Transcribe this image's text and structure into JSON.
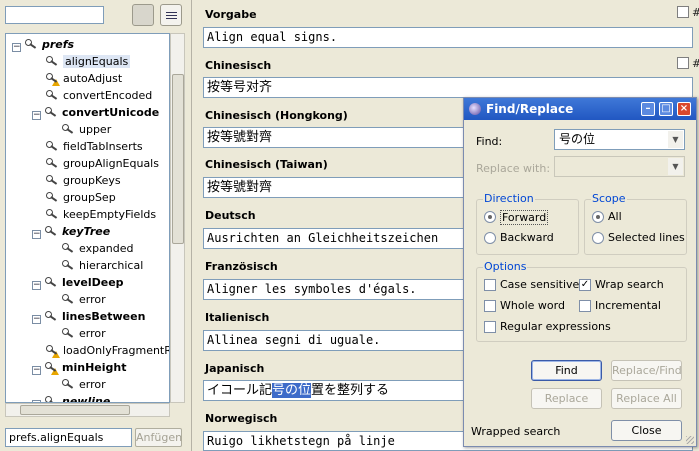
{
  "left": {
    "filter_value": "",
    "tree": [
      {
        "label": "prefs",
        "icon": "key-icon",
        "style": "bold-italic",
        "expander": "minus",
        "selected": false,
        "warn": false
      },
      {
        "label": "alignEquals",
        "icon": "key-icon",
        "style": "normal",
        "selected": true,
        "warn": false
      },
      {
        "label": "autoAdjust",
        "icon": "key-warning-icon",
        "style": "normal",
        "selected": false,
        "warn": true
      },
      {
        "label": "convertEncoded",
        "icon": "key-icon",
        "style": "normal",
        "selected": false,
        "warn": false
      },
      {
        "label": "convertUnicode",
        "icon": "key-icon",
        "style": "bold",
        "expander": "minus",
        "selected": false,
        "warn": false
      },
      {
        "label": "upper",
        "icon": "key-icon",
        "style": "normal",
        "selected": false,
        "warn": false
      },
      {
        "label": "fieldTabInserts",
        "icon": "key-icon",
        "style": "normal",
        "selected": false,
        "warn": false
      },
      {
        "label": "groupAlignEquals",
        "icon": "key-icon",
        "style": "normal",
        "selected": false,
        "warn": false
      },
      {
        "label": "groupKeys",
        "icon": "key-icon",
        "style": "normal",
        "selected": false,
        "warn": false
      },
      {
        "label": "groupSep",
        "icon": "key-icon",
        "style": "normal",
        "selected": false,
        "warn": false
      },
      {
        "label": "keepEmptyFields",
        "icon": "key-icon",
        "style": "normal",
        "selected": false,
        "warn": false
      },
      {
        "label": "keyTree",
        "icon": "key-icon",
        "style": "bold-italic",
        "expander": "minus",
        "selected": false,
        "warn": false
      },
      {
        "label": "expanded",
        "icon": "key-icon",
        "style": "normal",
        "selected": false,
        "warn": false
      },
      {
        "label": "hierarchical",
        "icon": "key-icon",
        "style": "normal",
        "selected": false,
        "warn": false
      },
      {
        "label": "levelDeep",
        "icon": "key-icon",
        "style": "bold",
        "expander": "minus",
        "selected": false,
        "warn": false
      },
      {
        "label": "error",
        "icon": "key-icon",
        "style": "normal",
        "selected": false,
        "warn": false
      },
      {
        "label": "linesBetween",
        "icon": "key-icon",
        "style": "bold",
        "expander": "minus",
        "selected": false,
        "warn": false
      },
      {
        "label": "error",
        "icon": "key-icon",
        "style": "normal",
        "selected": false,
        "warn": false
      },
      {
        "label": "loadOnlyFragmentRe",
        "icon": "key-warning-icon",
        "style": "normal",
        "selected": false,
        "warn": true
      },
      {
        "label": "minHeight",
        "icon": "key-warning-icon",
        "style": "bold",
        "expander": "minus",
        "selected": false,
        "warn": true
      },
      {
        "label": "error",
        "icon": "key-icon",
        "style": "normal",
        "selected": false,
        "warn": false
      },
      {
        "label": "newline",
        "icon": "key-icon",
        "style": "bold-italic",
        "expander": "minus",
        "selected": false,
        "warn": false
      }
    ],
    "key_input": "prefs.alignEquals",
    "add_button": "Anfügen"
  },
  "main": {
    "sections": [
      {
        "label": "Vorgabe",
        "value": "Align equal signs.",
        "cjk": false,
        "hash": true
      },
      {
        "label": "Chinesisch",
        "value": "按等号对齐",
        "cjk": true,
        "hash": true
      },
      {
        "label": "Chinesisch (Hongkong)",
        "value": "按等號對齊",
        "cjk": true,
        "hash": false
      },
      {
        "label": "Chinesisch (Taiwan)",
        "value": "按等號對齊",
        "cjk": true,
        "hash": false
      },
      {
        "label": "Deutsch",
        "value": "Ausrichten an Gleichheitszeichen",
        "cjk": false,
        "hash": false
      },
      {
        "label": "Französisch",
        "value": "Aligner les symboles d'égals.",
        "cjk": false,
        "hash": false
      },
      {
        "label": "Italienisch",
        "value": "Allinea segni di uguale.",
        "cjk": false,
        "hash": false
      },
      {
        "label": "Japanisch",
        "value_pre": "イコール記",
        "value_hl": "号の位",
        "value_post": "置を整列する",
        "cjk": true,
        "hash": false
      },
      {
        "label": "Norwegisch",
        "value": "Ruigo likhetstegn på linje",
        "cjk": false,
        "hash": false
      }
    ],
    "hash_symbol": "#"
  },
  "dialog": {
    "title": "Find/Replace",
    "find_label": "Find:",
    "find_value": "号の位",
    "replace_label": "Replace with:",
    "replace_value": "",
    "direction": {
      "title": "Direction",
      "forward": "Forward",
      "backward": "Backward",
      "selected": "forward"
    },
    "scope": {
      "title": "Scope",
      "all": "All",
      "selected_lines": "Selected lines",
      "selected": "all"
    },
    "options": {
      "title": "Options",
      "case_sensitive": {
        "label": "Case sensitive",
        "checked": false
      },
      "wrap_search": {
        "label": "Wrap search",
        "checked": true
      },
      "whole_word": {
        "label": "Whole word",
        "checked": false
      },
      "incremental": {
        "label": "Incremental",
        "checked": false
      },
      "regex": {
        "label": "Regular expressions",
        "checked": false
      }
    },
    "buttons": {
      "find": "Find",
      "replace_find": "Replace/Find",
      "replace": "Replace",
      "replace_all": "Replace All",
      "close": "Close"
    },
    "status": "Wrapped search"
  }
}
